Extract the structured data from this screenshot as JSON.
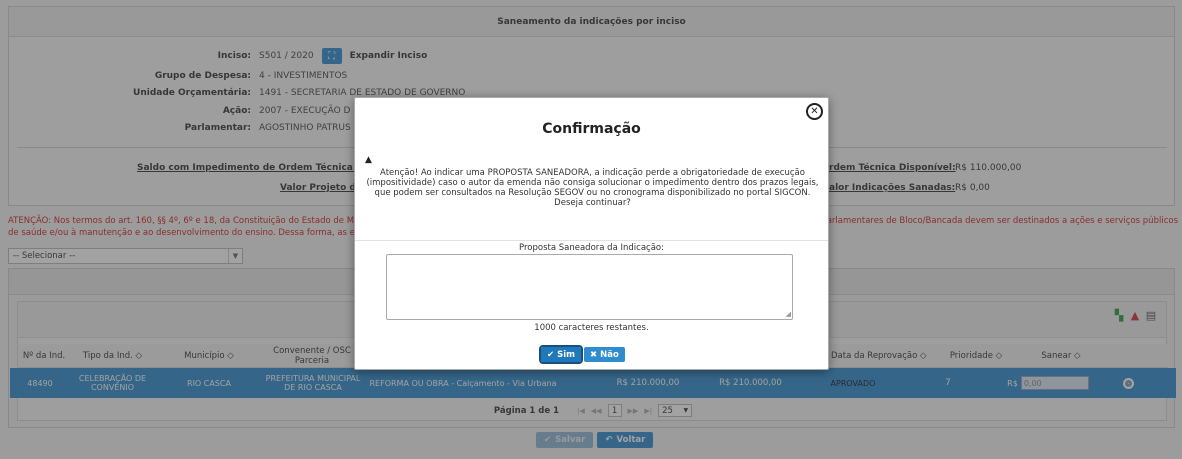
{
  "panel": {
    "title": "Saneamento da indicações por inciso",
    "fields": [
      {
        "label": "Inciso:",
        "value": "S501 / 2020"
      },
      {
        "label": "Grupo de Despesa:",
        "value": "4 - INVESTIMENTOS"
      },
      {
        "label": "Unidade Orçamentária:",
        "value": "1491 - SECRETARIA DE ESTADO DE GOVERNO"
      },
      {
        "label": "Ação:",
        "value": "2007 - EXECUÇÃO D"
      },
      {
        "label": "Parlamentar:",
        "value": "AGOSTINHO PATRUS"
      }
    ],
    "expand_label": "Expandir Inciso",
    "saldo_left_1": "Saldo com Impedimento de Ordem Técnica do Inc",
    "saldo_left_2": "Valor Projeto de",
    "saldo_right_1_label": "rdem Técnica Disponível:",
    "saldo_right_1_value": "R$ 110.000,00",
    "saldo_right_2_label": "alor Indicações Sanadas:",
    "saldo_right_2_value": "R$ 0,00"
  },
  "warning": {
    "line1_left": "ATENÇÃO: Nos termos do art. 160, §§ 4º, 6º e 18, da Constituição do Estado de Minas Ge",
    "line1_right": "nendas parlamentares de Bloco/Bancada devem ser destinados a ações e serviços públicos",
    "line2_left": "de saúde e/ou à manutenção e ao desenvolvimento do ensino. Dessa forma, as escolhas d"
  },
  "select": {
    "value": "-- Selecionar --"
  },
  "grid": {
    "columns": [
      "Nº da Ind.",
      "Tipo da Ind.",
      "Município",
      "Convenente / OSC Parceria",
      "Data da Reprovação",
      "Prioridade",
      "Sanear"
    ],
    "row": {
      "num": "48490",
      "tipo": "CELEBRAÇÃO DE CONVÊNIO",
      "municipio": "RIO CASCA",
      "convenente": "PREFEITURA MUNICIPAL DE RIO CASCA",
      "objeto": "REFORMA OU OBRA - Calçamento - Via Urbana",
      "valor1": "R$ 210.000,00",
      "valor2": "R$ 210.000,00",
      "status": "APROVADO",
      "prioridade": "7",
      "sanear_prefix": "R$",
      "sanear_placeholder": "0,00"
    },
    "pager": {
      "text": "Página 1 de 1",
      "page": "1",
      "size": "25"
    }
  },
  "buttons": {
    "salvar": "Salvar",
    "voltar": "Voltar"
  },
  "modal": {
    "title": "Confirmação",
    "message": "Atenção! Ao indicar uma PROPOSTA SANEADORA, a indicação perde a obrigatoriedade de execução (impositividade) caso o autor da emenda não consiga solucionar o impedimento dentro dos prazos legais, que podem ser consultados na Resolução SEGOV ou no cronograma disponibilizado no portal SIGCON. Deseja continuar?",
    "field_label": "Proposta Saneadora da Indicação:",
    "chars_left": "1000 caracteres restantes.",
    "yes": "Sim",
    "no": "Não"
  },
  "colors": {
    "primary": "#2e8ccf",
    "warning": "#d02020"
  }
}
